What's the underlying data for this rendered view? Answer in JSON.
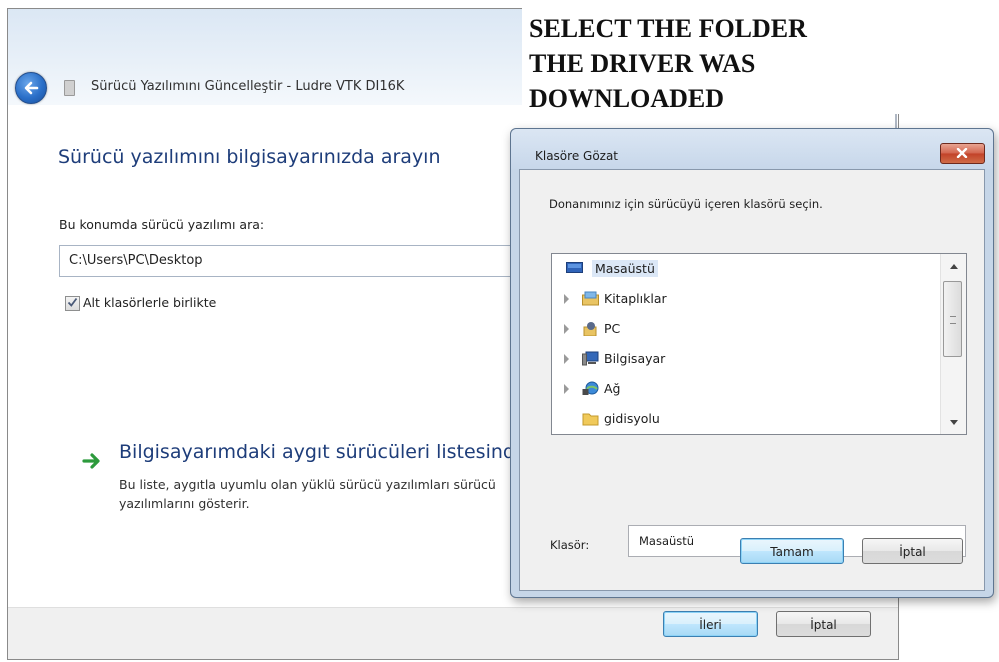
{
  "wizard": {
    "title": "Sürücü Yazılımını Güncelleştir - Ludre VTK DI16K",
    "heading": "Sürücü yazılımını bilgisayarınızda arayın",
    "search_label": "Bu konumda sürücü yazılımı ara:",
    "path_value": "C:\\Users\\PC\\Desktop",
    "include_subfolders_label": "Alt klasörlerle birlikte",
    "include_subfolders_checked": true,
    "list_option_title": "Bilgisayarımdaki aygıt sürücüleri listesind",
    "list_option_description": "Bu liste, aygıtla uyumlu olan yüklü sürücü yazılımları sürücü yazılımlarını gösterir.",
    "next_label": "İleri",
    "cancel_label": "İptal"
  },
  "instruction_overlay": {
    "text": "SELECT THE FOLDER\nTHE DRIVER WAS\nDOWNLOADED"
  },
  "browse_dialog": {
    "title": "Klasöre Gözat",
    "instruction": "Donanımınız için sürücüyü içeren klasörü seçin.",
    "tree_items": [
      {
        "label": "Masaüstü",
        "icon": "desktop-icon",
        "expandable": false,
        "selected": true
      },
      {
        "label": "Kitaplıklar",
        "icon": "libraries-icon",
        "expandable": true,
        "selected": false
      },
      {
        "label": "PC",
        "icon": "user-icon",
        "expandable": true,
        "selected": false
      },
      {
        "label": "Bilgisayar",
        "icon": "computer-icon",
        "expandable": true,
        "selected": false
      },
      {
        "label": "Ağ",
        "icon": "network-icon",
        "expandable": true,
        "selected": false
      },
      {
        "label": "gidisyolu",
        "icon": "folder-icon",
        "expandable": false,
        "selected": false
      }
    ],
    "folder_label": "Klasör:",
    "folder_value": "Masaüstü",
    "ok_label": "Tamam",
    "cancel_label": "İptal"
  },
  "colors": {
    "heading_blue": "#1e3d7a",
    "close_red": "#c24128",
    "selection_highlight": "#dbe7f6"
  }
}
